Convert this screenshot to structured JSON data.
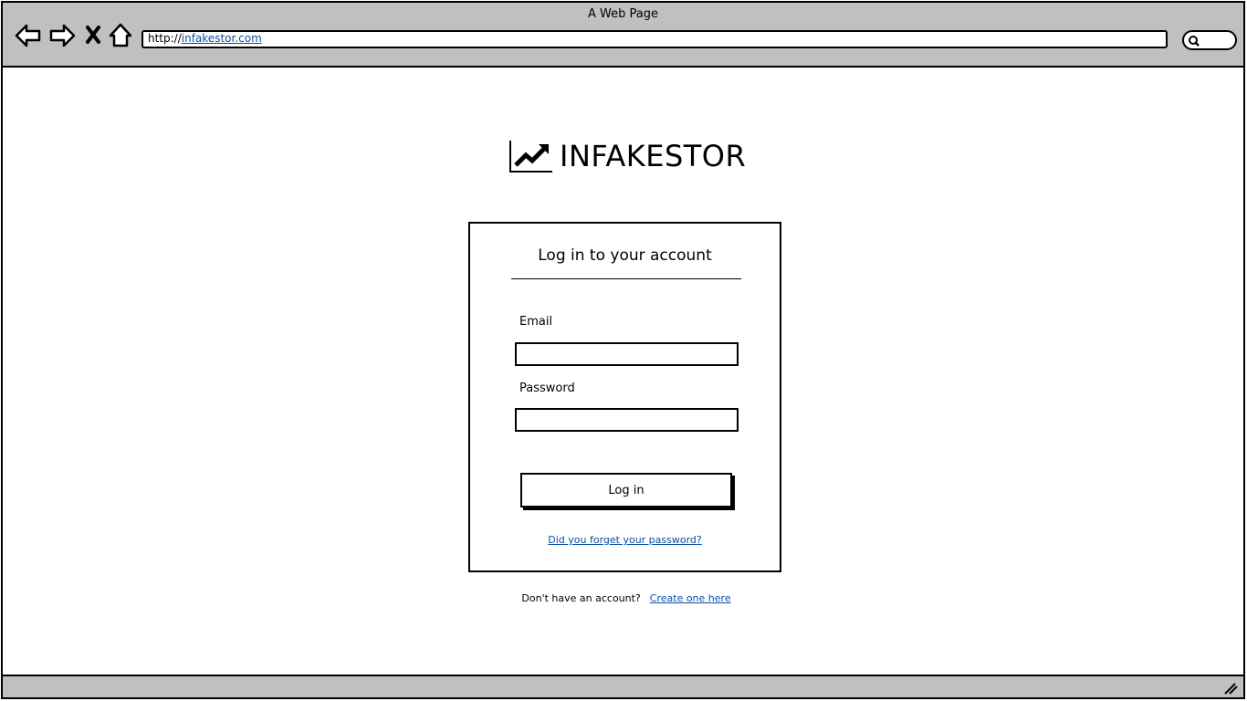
{
  "window": {
    "title": "A Web Page"
  },
  "toolbar": {
    "icons": [
      "back-arrow-icon",
      "forward-arrow-icon",
      "stop-icon",
      "home-icon"
    ],
    "address": {
      "protocol": "http://",
      "host": "infakestor.com"
    },
    "search_icon": "search-icon"
  },
  "logo": {
    "icon": "trending-up-chart-icon",
    "text": "INFAKESTOR"
  },
  "login": {
    "title": "Log in to your account",
    "email_label": "Email",
    "email_value": "",
    "password_label": "Password",
    "password_value": "",
    "submit_label": "Log in",
    "forgot_link": "Did you forget your password?"
  },
  "signup": {
    "text": "Don't have an account?",
    "link": "Create one here"
  },
  "colors": {
    "chrome": "#c0c0c0",
    "link": "#0b4ea2"
  }
}
